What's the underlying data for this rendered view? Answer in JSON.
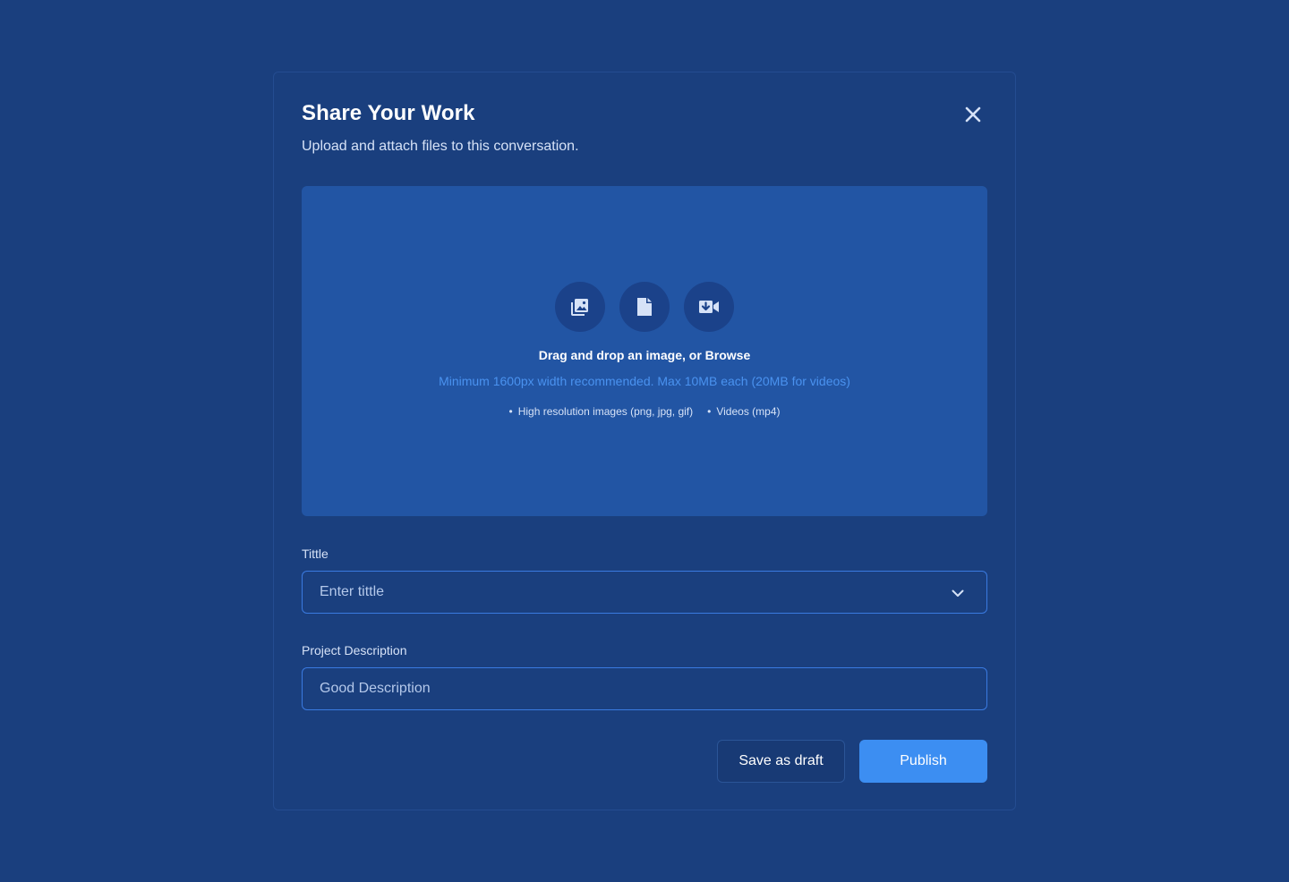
{
  "modal": {
    "title": "Share Your Work",
    "subtitle": "Upload and attach files to this conversation."
  },
  "dropzone": {
    "icons": [
      "image-gallery-icon",
      "document-icon",
      "video-upload-icon"
    ],
    "heading": "Drag and drop an image, or Browse",
    "hint": "Minimum 1600px width recommended. Max 10MB each (20MB for videos)",
    "formats": [
      "High resolution images (png, jpg, gif)",
      "Videos (mp4)"
    ]
  },
  "fields": {
    "title": {
      "label": "Tittle",
      "placeholder": "Enter tittle",
      "value": ""
    },
    "description": {
      "label": "Project Description",
      "placeholder": "Good Description",
      "value": ""
    }
  },
  "actions": {
    "draft_label": "Save as draft",
    "publish_label": "Publish"
  },
  "colors": {
    "background": "#1a3f7e",
    "dropzone": "#2255a4",
    "icon_circle": "#1b428a",
    "accent": "#3c8ef2",
    "hint_text": "#4a92ef",
    "field_border": "#3a7ae0"
  }
}
